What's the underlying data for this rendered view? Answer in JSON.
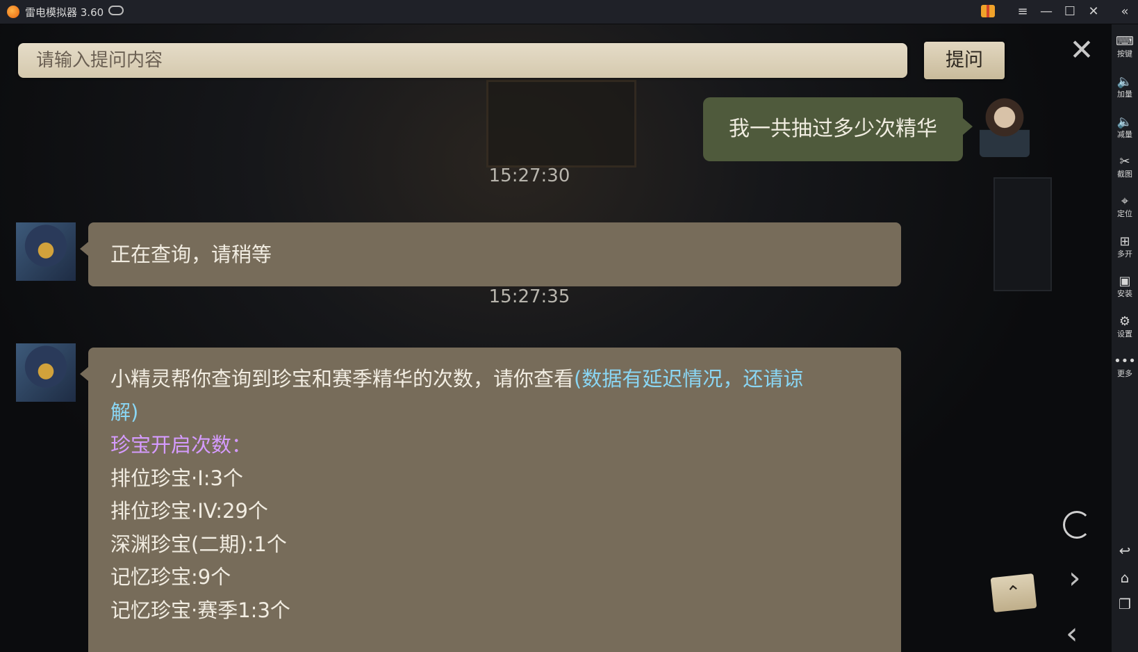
{
  "window": {
    "title": "雷电模拟器 3.60",
    "controls": [
      "≡",
      "—",
      "☐",
      "✕"
    ],
    "collapse_icon": "«"
  },
  "search": {
    "placeholder": "请输入提问内容",
    "button_label": "提问"
  },
  "close_icon": "✕",
  "chat": {
    "user_message": "我一共抽过多少次精华",
    "timestamp_1": "15:27:30",
    "reply_1": "正在查询，请稍等",
    "timestamp_2": "15:27:35",
    "reply_2": {
      "intro": "小精灵帮你查询到珍宝和赛季精华的次数，请你查看",
      "note_part1": "(数据有延迟情况，还请谅",
      "note_part2": "解)",
      "section_title": "珍宝开启次数：",
      "items": [
        "排位珍宝·I:3个",
        "排位珍宝·IV:29个",
        "深渊珍宝(二期):1个",
        "记忆珍宝:9个",
        "记忆珍宝·赛季1:3个"
      ]
    }
  },
  "game_controls": {
    "scroll_top_label": "⌃",
    "next_icon": "›",
    "prev_icon": "‹"
  },
  "toolbar": {
    "items": [
      {
        "icon": "keyboard-icon",
        "glyph": "⌨",
        "label": "按键"
      },
      {
        "icon": "volume-up-icon",
        "glyph": "🔈",
        "label": "加量"
      },
      {
        "icon": "volume-down-icon",
        "glyph": "🔈",
        "label": "减量"
      },
      {
        "icon": "scissors-icon",
        "glyph": "✂",
        "label": "截图"
      },
      {
        "icon": "location-icon",
        "glyph": "⌖",
        "label": "定位"
      },
      {
        "icon": "multi-open-icon",
        "glyph": "⊞",
        "label": "多开"
      },
      {
        "icon": "apk-install-icon",
        "glyph": "▣",
        "label": "安装"
      },
      {
        "icon": "settings-icon",
        "glyph": "⚙",
        "label": "设置"
      },
      {
        "icon": "more-icon",
        "glyph": "•••",
        "label": "更多"
      }
    ],
    "nav": [
      {
        "icon": "back-icon",
        "glyph": "↩"
      },
      {
        "icon": "home-icon",
        "glyph": "⌂"
      },
      {
        "icon": "recent-apps-icon",
        "glyph": "❐"
      }
    ]
  }
}
